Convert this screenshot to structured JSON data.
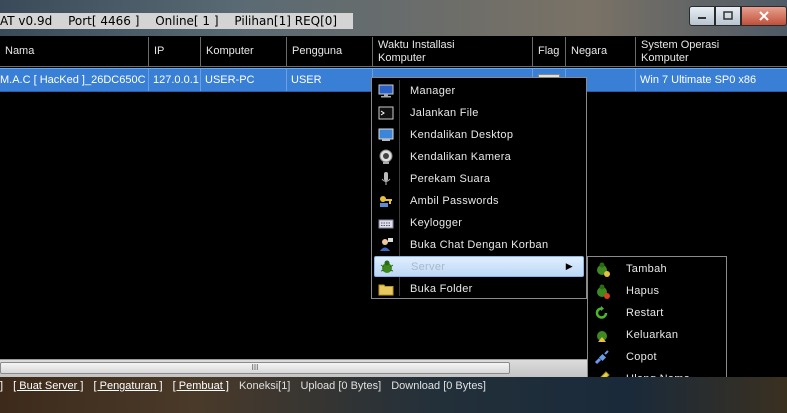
{
  "titlebar": {
    "app": "AT v0.9d",
    "port": "Port[ 4466 ]",
    "online": "Online[ 1 ]",
    "pilihan": "Pilihan[1] REQ[0]"
  },
  "columns": [
    {
      "label": "Nama"
    },
    {
      "label": "IP"
    },
    {
      "label": "Komputer"
    },
    {
      "label": "Pengguna"
    },
    {
      "label": "Waktu Installasi\nKomputer"
    },
    {
      "label": "Flag"
    },
    {
      "label": "Negara"
    },
    {
      "label": "System Operasi\nKomputer"
    }
  ],
  "row": {
    "nama": "M.A.C [ HacKed ]_26DC650C",
    "ip": "127.0.0.1",
    "komputer": "USER-PC",
    "pengguna": "USER",
    "os": "Win 7 Ultimate SP0 x86"
  },
  "menu": {
    "items": [
      {
        "label": "Manager",
        "icon": "monitor-icon"
      },
      {
        "label": "Jalankan File",
        "icon": "terminal-icon"
      },
      {
        "label": "Kendalikan Desktop",
        "icon": "desktop-icon"
      },
      {
        "label": "Kendalikan Kamera",
        "icon": "webcam-icon"
      },
      {
        "label": "Perekam Suara",
        "icon": "microphone-icon"
      },
      {
        "label": "Ambil  Passwords",
        "icon": "key-icon"
      },
      {
        "label": "Keylogger",
        "icon": "keyboard-icon"
      },
      {
        "label": "Buka Chat Dengan Korban",
        "icon": "chat-user-icon"
      },
      {
        "label": "Server",
        "icon": "bug-icon"
      },
      {
        "label": "Buka Folder",
        "icon": "folder-icon"
      }
    ]
  },
  "submenu": {
    "items": [
      {
        "label": "Tambah",
        "icon": "bug-add-icon"
      },
      {
        "label": "Hapus",
        "icon": "bug-delete-icon"
      },
      {
        "label": "Restart",
        "icon": "refresh-icon"
      },
      {
        "label": "Keluarkan",
        "icon": "bug-exit-icon"
      },
      {
        "label": "Copot",
        "icon": "unplug-icon"
      },
      {
        "label": "Ulang Nama",
        "icon": "pencil-icon"
      }
    ]
  },
  "footer": {
    "l0": "]",
    "buat_server": "[ Buat Server ]",
    "pengaturan": "[ Pengaturan ]",
    "pembuat": "[ Pembuat ]",
    "koneksi": "Koneksi[1]",
    "upload": "Upload [0 Bytes]",
    "download": "Download [0 Bytes]"
  },
  "scrollbar": {
    "grip": "III"
  }
}
